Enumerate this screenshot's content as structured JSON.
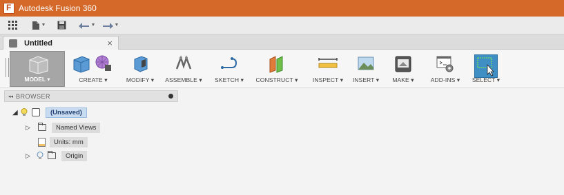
{
  "window": {
    "title": "Autodesk Fusion 360"
  },
  "quick_access": {
    "icons": [
      "grid-icon",
      "file-icon",
      "save-icon",
      "undo-icon",
      "redo-icon"
    ]
  },
  "document_tab": {
    "label": "Untitled",
    "close": "×"
  },
  "toolbar": {
    "workspace_label": "MODEL ▾",
    "items": [
      {
        "label": "CREATE ▾",
        "icon": "create-icon"
      },
      {
        "label": "MODIFY ▾",
        "icon": "modify-icon"
      },
      {
        "label": "ASSEMBLE ▾",
        "icon": "assemble-icon"
      },
      {
        "label": "SKETCH ▾",
        "icon": "sketch-icon"
      },
      {
        "label": "CONSTRUCT ▾",
        "icon": "construct-icon"
      },
      {
        "label": "INSPECT ▾",
        "icon": "inspect-icon"
      },
      {
        "label": "INSERT ▾",
        "icon": "insert-icon"
      },
      {
        "label": "MAKE ▾",
        "icon": "make-icon"
      },
      {
        "label": "ADD-INS ▾",
        "icon": "addins-icon"
      },
      {
        "label": "SELECT ▾",
        "icon": "select-icon"
      }
    ]
  },
  "browser": {
    "title": "BROWSER",
    "collapse": "◂◂",
    "tree": {
      "root": {
        "label": "(Unsaved)",
        "expander": "◢"
      },
      "children": [
        {
          "label": "Named Views",
          "expander": "▷"
        },
        {
          "label": "Units: mm"
        },
        {
          "label": "Origin",
          "expander": "▷"
        }
      ]
    }
  },
  "colors": {
    "title_bar": "#d4692a",
    "select_accent": "#3f8fc5",
    "root_highlight": "#c8dbf0"
  }
}
